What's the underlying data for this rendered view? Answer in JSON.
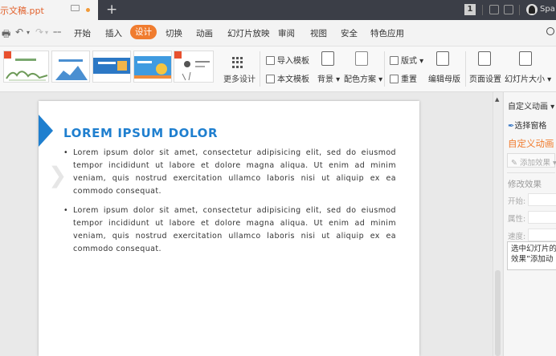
{
  "titlebar": {
    "tab_title": "示文稿.ppt",
    "new_tab": "+",
    "badge": "1",
    "user": "Spa"
  },
  "menu": {
    "items": [
      "开始",
      "插入",
      "设计",
      "切换",
      "动画",
      "幻灯片放映",
      "审阅",
      "视图",
      "安全",
      "特色应用"
    ],
    "active": "设计"
  },
  "ribbon": {
    "more_designs": "更多设计",
    "import_template": "导入模板",
    "this_template": "本文模板",
    "background": "背景",
    "color_scheme": "配色方案",
    "layout": "版式",
    "reset": "重置",
    "edit_master": "编辑母版",
    "page_setup": "页面设置",
    "slide_size": "幻灯片大小"
  },
  "slide": {
    "title": "LOREM IPSUM DOLOR",
    "bullets": [
      "Lorem ipsum dolor sit amet, consectetur adipisicing elit, sed do eiusmod tempor incididunt ut labore et dolore magna aliqua. Ut enim ad minim veniam, quis nostrud exercitation ullamco laboris nisi ut aliquip ex ea commodo consequat.",
      "Lorem ipsum dolor sit amet, consectetur adipisicing elit, sed do eiusmod tempor incididunt ut labore et dolore magna aliqua. Ut enim ad minim veniam, quis nostrud exercitation ullamco laboris nisi ut aliquip ex ea commodo consequat."
    ]
  },
  "pane": {
    "header": "自定义动画",
    "select_pane": "选择窗格",
    "title": "自定义动画",
    "add_effect": "添加效果",
    "modify_effect": "修改效果",
    "start_label": "开始:",
    "property_label": "属性:",
    "speed_label": "速度:",
    "hint_line1": "选中幻灯片的",
    "hint_line2": "效果”添加动"
  },
  "colors": {
    "accent": "#f07c2f",
    "slide_title": "#1f7fcf",
    "titlebar": "#3b3e47"
  }
}
